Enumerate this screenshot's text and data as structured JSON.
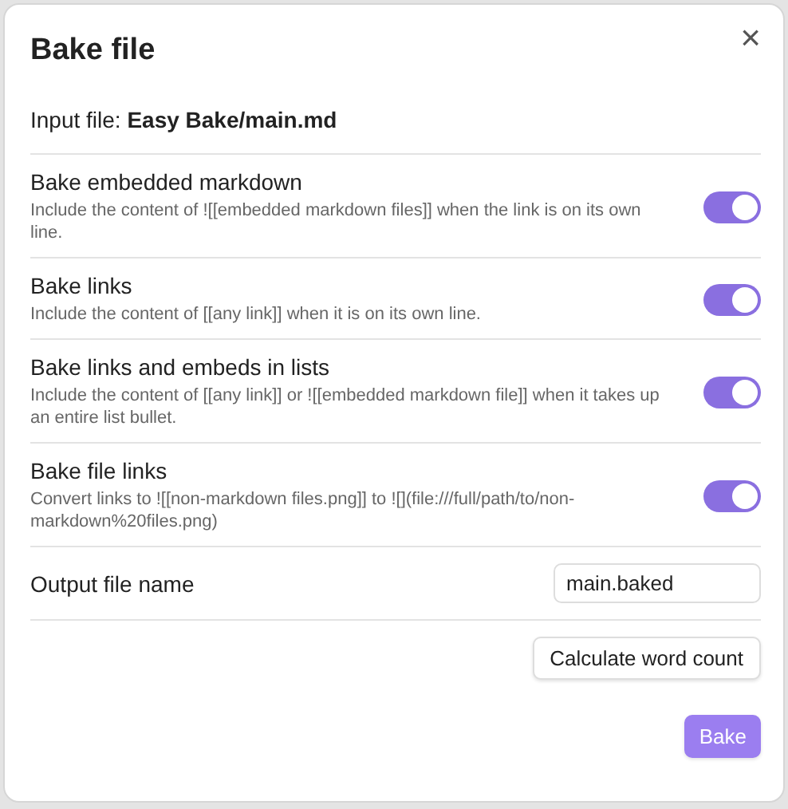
{
  "dialog": {
    "title": "Bake file",
    "close": "×",
    "input_file": "Input file: **Easy Bake/main.md**"
  },
  "settings": [
    {
      "name": "Bake embedded markdown",
      "description": "Include the content of ![[embedded markdown files]] when the link is on its own line.",
      "on": true
    },
    {
      "name": "Bake links",
      "description": "Include the content of [[any link]] when it is on its own line.",
      "on": true
    },
    {
      "name": "Bake links and embeds in lists",
      "description": "Include the content of [[any link]] or ![[embedded markdown file]] when it takes up an entire list bullet.",
      "on": true
    },
    {
      "name": "Bake file links",
      "description": "Convert links to ![[non-markdown files.png]] to ![](file:///full/path/to/non-markdown%20files.png)",
      "on": true
    }
  ],
  "output": {
    "label": "Output file name",
    "value": "main.baked"
  },
  "buttons": [
    {
      "label": "Calculate word count",
      "kind": "secondary"
    },
    {
      "label": "Bake",
      "kind": "primary"
    }
  ]
}
